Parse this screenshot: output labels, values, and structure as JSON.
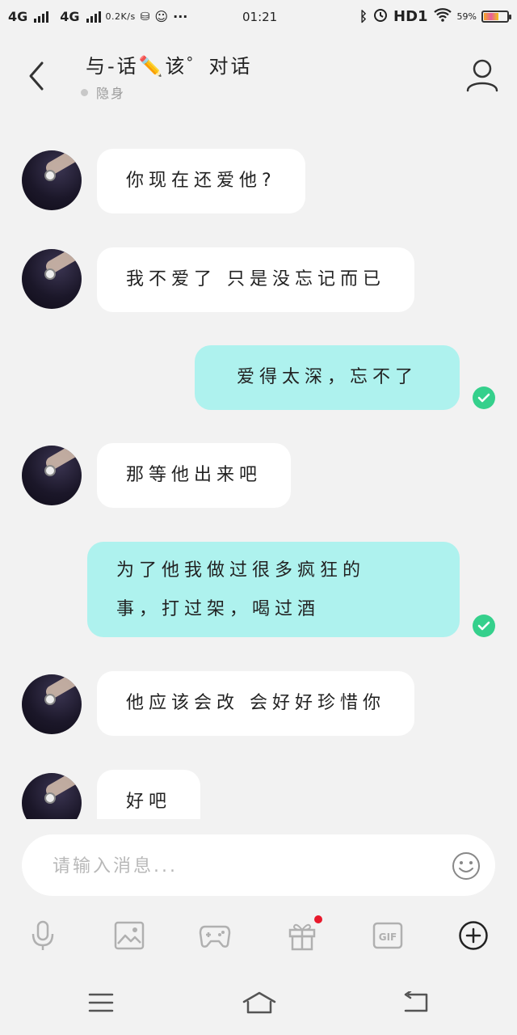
{
  "status_bar": {
    "network1": "4G",
    "network2": "4G",
    "speed": "0.2K/s",
    "time": "01:21",
    "hd": "HD1",
    "battery_percent": "59%",
    "battery_level": 0.59
  },
  "header": {
    "title": "与-话✏️该゜对话",
    "status": "隐身"
  },
  "messages": [
    {
      "side": "in",
      "text": "你现在还爱他?"
    },
    {
      "side": "in",
      "text": "我不爱了 只是没忘记而已"
    },
    {
      "side": "out",
      "text": "爱得太深，忘不了",
      "read": true
    },
    {
      "side": "in",
      "text": "那等他出来吧"
    },
    {
      "side": "out",
      "text": "为了他我做过很多疯狂的事，打过架，喝过酒",
      "line1": "为了他我做过很多疯狂的",
      "line2": "事，打过架，喝过酒",
      "read": true
    },
    {
      "side": "in",
      "text": "他应该会改 会好好珍惜你"
    },
    {
      "side": "in",
      "text": "好吧"
    }
  ],
  "input": {
    "placeholder": "请输入消息..."
  },
  "toolbar": {
    "icons": [
      "microphone-icon",
      "image-icon",
      "gamepad-icon",
      "gift-icon",
      "gif-icon",
      "add-circle-icon"
    ],
    "gif_label": "GIF",
    "gift_has_badge": true
  },
  "colors": {
    "background": "#f2f2f2",
    "incoming_bubble": "#ffffff",
    "outgoing_bubble": "#aef2ee",
    "read_check": "#35d08c",
    "badge": "#e8192c"
  }
}
